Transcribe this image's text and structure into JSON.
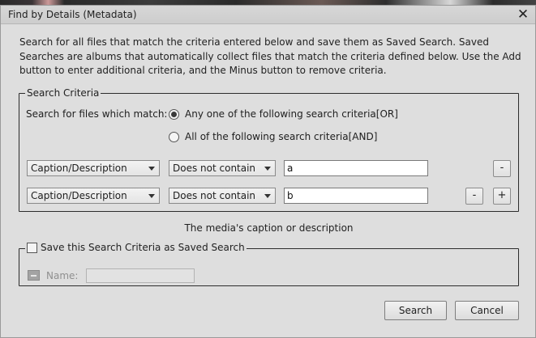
{
  "dialog": {
    "title": "Find by Details (Metadata)",
    "close_glyph": "✕",
    "description": "Search for all files that match the criteria entered below and save them as Saved Search. Saved Searches are albums that automatically collect files that match the criteria defined below. Use the Add button to enter additional criteria, and the Minus button to remove criteria."
  },
  "criteria": {
    "legend": "Search Criteria",
    "match_label": "Search for files which match:",
    "options": [
      {
        "label": "Any one of the following search criteria[OR]",
        "selected": true
      },
      {
        "label": "All of the following search criteria[AND]",
        "selected": false
      }
    ],
    "rows": [
      {
        "field": "Caption/Description",
        "operator": "Does not contain",
        "value": "a"
      },
      {
        "field": "Caption/Description",
        "operator": "Does not contain",
        "value": "b"
      }
    ],
    "minus_label": "-",
    "plus_label": "+",
    "hint": "The media's caption or description"
  },
  "save": {
    "legend": "Save this Search Criteria as Saved Search",
    "checked": false,
    "name_label": "Name:",
    "name_value": ""
  },
  "buttons": {
    "search": "Search",
    "cancel": "Cancel"
  }
}
